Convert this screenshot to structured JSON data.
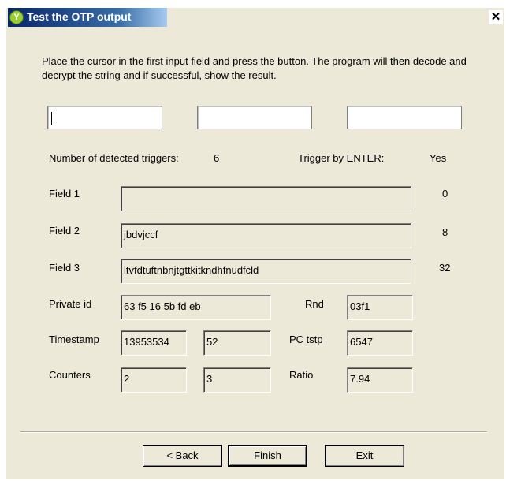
{
  "window": {
    "title": "Test the OTP output",
    "icon": "yubikey-app-icon",
    "close_label": "✕"
  },
  "instructions": "Place the cursor in the first input field and press the button. The program will then decode and decrypt the string and if successful, show the result.",
  "inputs": [
    {
      "value": "",
      "focused": true
    },
    {
      "value": ""
    },
    {
      "value": ""
    }
  ],
  "status": {
    "triggers_label": "Number of detected triggers:",
    "triggers_value": "6",
    "enter_label": "Trigger by ENTER:",
    "enter_value": "Yes"
  },
  "fields": [
    {
      "label": "Field 1",
      "value": "",
      "length": "0"
    },
    {
      "label": "Field 2",
      "value": "jbdvjccf",
      "length": "8"
    },
    {
      "label": "Field 3",
      "value": "ltvfdtuftnbnjtgttkitkndhfnudfcld",
      "length": "32"
    }
  ],
  "details": {
    "private_id_label": "Private id",
    "private_id": "63 f5 16 5b fd eb",
    "rnd_label": "Rnd",
    "rnd": "03f1",
    "timestamp_label": "Timestamp",
    "timestamp_1": "13953534",
    "timestamp_2": "52",
    "pc_tstp_label": "PC tstp",
    "pc_tstp": "6547",
    "counters_label": "Counters",
    "counter_1": "2",
    "counter_2": "3",
    "ratio_label": "Ratio",
    "ratio": "7.94"
  },
  "buttons": {
    "back_prefix": "< ",
    "back_key": "B",
    "back_rest": "ack",
    "finish": "Finish",
    "exit": "Exit"
  }
}
